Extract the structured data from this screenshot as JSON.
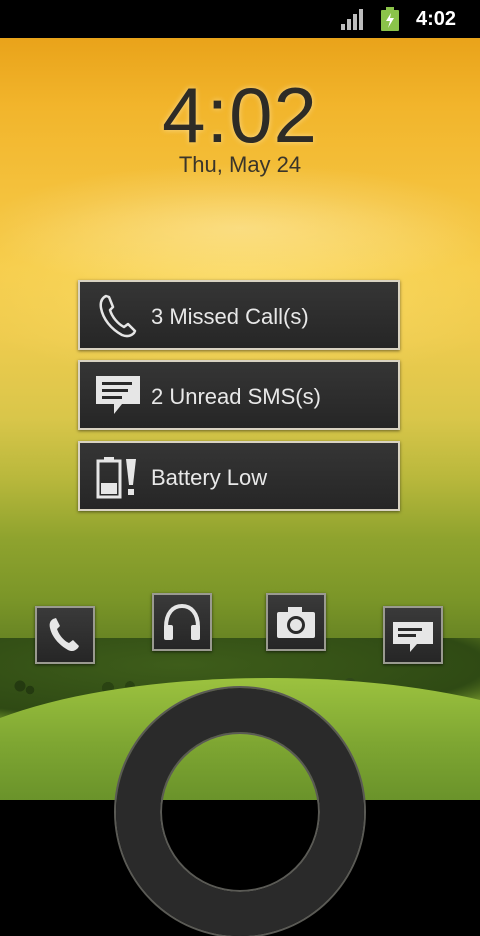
{
  "status_bar": {
    "time": "4:02",
    "signal_icon": "signal-bars-icon",
    "battery_icon": "battery-charging-icon",
    "battery_color": "#8bc34a"
  },
  "lock_screen": {
    "clock": "4:02",
    "date": "Thu, May 24"
  },
  "notifications": [
    {
      "icon": "phone-icon",
      "label": "3 Missed Call(s)"
    },
    {
      "icon": "message-icon",
      "label": "2 Unread SMS(s)"
    },
    {
      "icon": "battery-low-icon",
      "label": "Battery Low"
    }
  ],
  "shortcuts": [
    {
      "icon": "phone-icon"
    },
    {
      "icon": "headphones-icon"
    },
    {
      "icon": "camera-icon"
    },
    {
      "icon": "message-icon"
    }
  ],
  "unlock": {
    "icon": "unlock-ring-icon"
  }
}
